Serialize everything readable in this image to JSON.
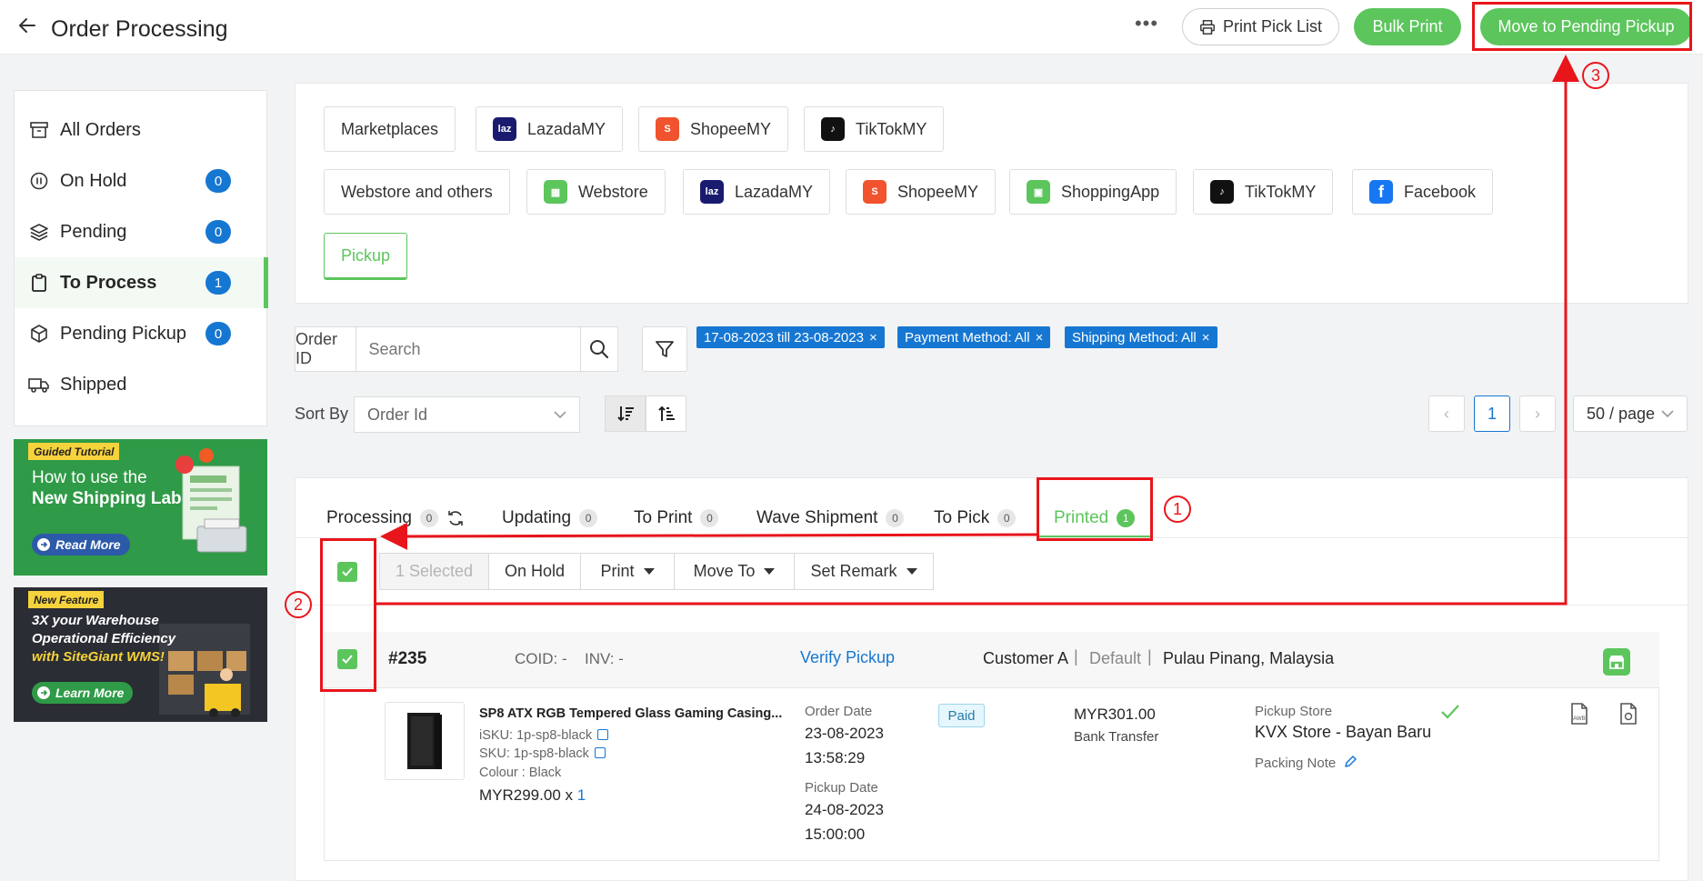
{
  "header": {
    "title": "Order Processing",
    "print_pick_list": "Print Pick List",
    "bulk_print": "Bulk Print",
    "move_to_pending_pickup": "Move to Pending Pickup"
  },
  "sidebar": {
    "items": [
      {
        "label": "All Orders",
        "icon": "archive-icon",
        "count": null
      },
      {
        "label": "On Hold",
        "icon": "pause-icon",
        "count": "0"
      },
      {
        "label": "Pending",
        "icon": "layers-icon",
        "count": "0"
      },
      {
        "label": "To Process",
        "icon": "clipboard-icon",
        "count": "1",
        "active": true
      },
      {
        "label": "Pending Pickup",
        "icon": "box-icon",
        "count": "0"
      },
      {
        "label": "Shipped",
        "icon": "truck-icon",
        "count": null
      }
    ]
  },
  "banners": {
    "tutorial": {
      "tag": "Guided Tutorial",
      "line1": "How to use the",
      "line2": "New Shipping Label?",
      "button": "Read More"
    },
    "feature": {
      "tag": "New Feature",
      "line1": "3X your Warehouse",
      "line2": "Operational Efficiency",
      "line3": "with SiteGiant WMS!",
      "button": "Learn More"
    }
  },
  "channels": {
    "row1": [
      "Marketplaces",
      "LazadaMY",
      "ShopeeMY",
      "TikTokMY"
    ],
    "row2": [
      "Webstore and others",
      "Webstore",
      "LazadaMY",
      "ShopeeMY",
      "ShoppingApp",
      "TikTokMY",
      "Facebook"
    ],
    "row3": [
      "Pickup"
    ]
  },
  "search": {
    "label": "Order ID",
    "placeholder": "Search"
  },
  "filters": {
    "date_range": "17-08-2023 till 23-08-2023",
    "payment": "Payment Method: All",
    "shipping": "Shipping Method: All"
  },
  "sort": {
    "label": "Sort By",
    "selected": "Order Id"
  },
  "pagination": {
    "current_page": "1",
    "per_page": "50 / page"
  },
  "tabs": [
    {
      "label": "Processing",
      "count": "0"
    },
    {
      "label": "Updating",
      "count": "0"
    },
    {
      "label": "To Print",
      "count": "0"
    },
    {
      "label": "Wave Shipment",
      "count": "0"
    },
    {
      "label": "To Pick",
      "count": "0"
    },
    {
      "label": "Printed",
      "count": "1",
      "active": true
    }
  ],
  "bulk_actions": {
    "selected": "1 Selected",
    "on_hold": "On Hold",
    "print": "Print",
    "move_to": "Move To",
    "set_remark": "Set Remark"
  },
  "order": {
    "id": "#235",
    "coid": "COID: -",
    "inv": "INV: -",
    "verify": "Verify Pickup",
    "customer": "Customer A",
    "address_type": "Default",
    "location": "Pulau Pinang, Malaysia",
    "product_name": "SP8 ATX RGB Tempered Glass Gaming Casing...",
    "isku": "iSKU: 1p-sp8-black",
    "sku": "SKU: 1p-sp8-black",
    "variant": "Colour : Black",
    "unit_price": "MYR299.00 x",
    "qty": "1",
    "order_date_label": "Order Date",
    "order_date": "23-08-2023",
    "order_time": "13:58:29",
    "pickup_date_label": "Pickup Date",
    "pickup_date": "24-08-2023",
    "pickup_time": "15:00:00",
    "payment_status": "Paid",
    "total": "MYR301.00",
    "payment_method": "Bank Transfer",
    "pickup_store_label": "Pickup Store",
    "pickup_store": "KVX Store - Bayan Baru",
    "packing_note": "Packing Note"
  },
  "annotations": {
    "step1": "1",
    "step2": "2",
    "step3": "3",
    "color": "#e8151b"
  },
  "colors": {
    "accent_green": "#5cc55c",
    "accent_blue": "#1677d2"
  }
}
